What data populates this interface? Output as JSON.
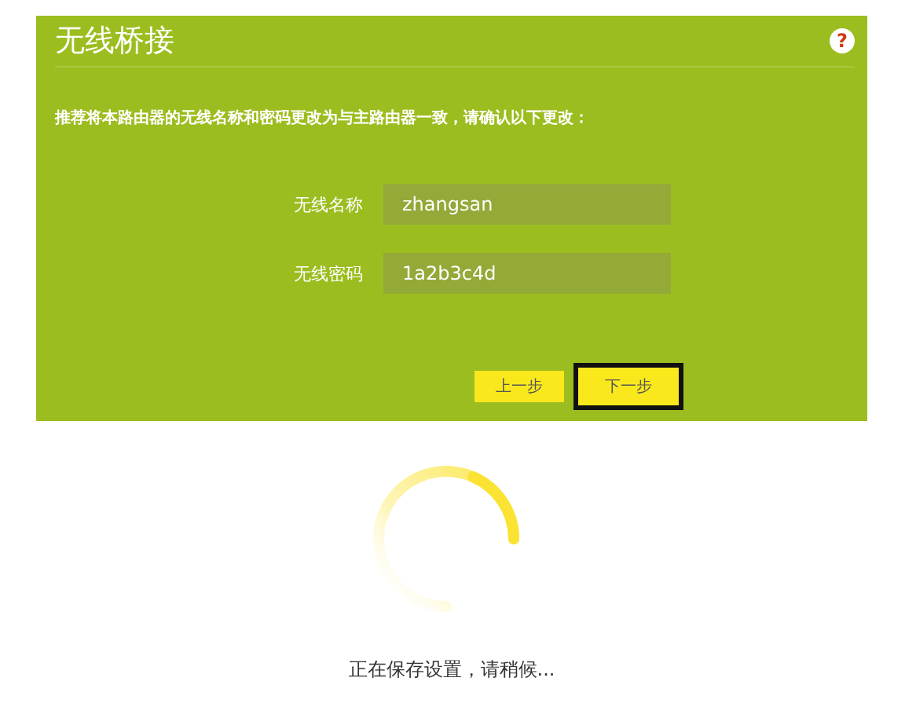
{
  "panel": {
    "title": "无线桥接",
    "help": "?",
    "instruction": "推荐将本路由器的无线名称和密码更改为与主路由器一致，请确认以下更改：",
    "fields": [
      {
        "label": "无线名称",
        "value": "zhangsan"
      },
      {
        "label": "无线密码",
        "value": "1a2b3c4d"
      }
    ],
    "buttons": [
      {
        "label": "上一步",
        "focused": false
      },
      {
        "label": "下一步",
        "focused": true
      }
    ]
  },
  "status": {
    "message": "正在保存设置，请稍候..."
  }
}
